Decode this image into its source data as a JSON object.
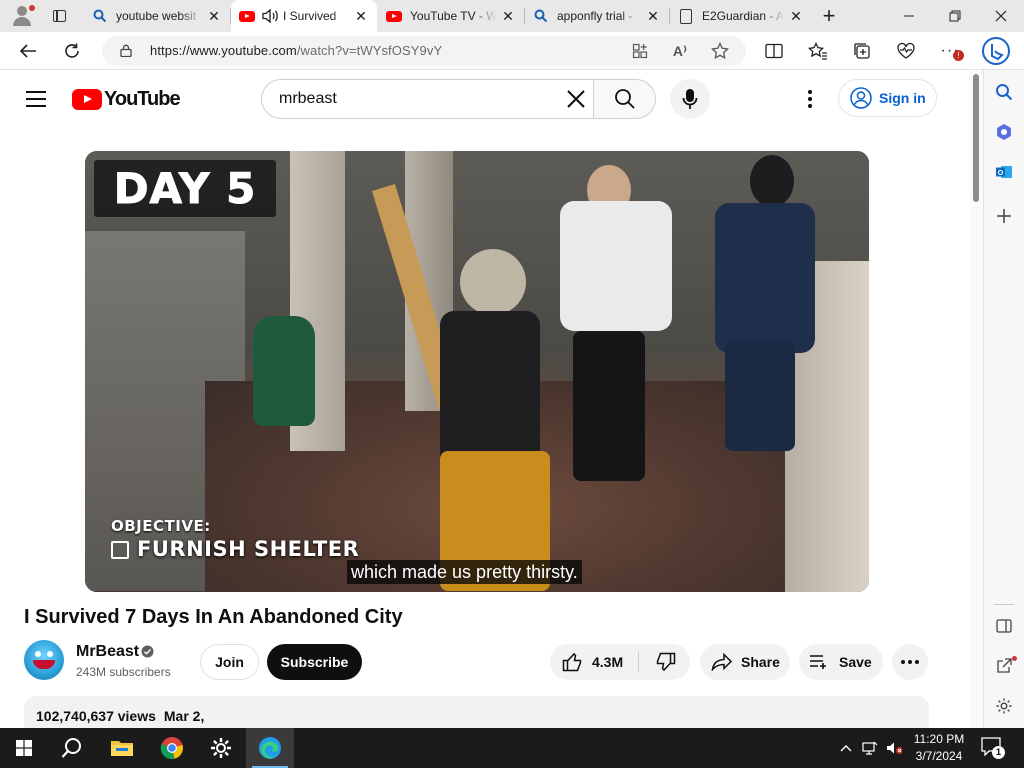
{
  "browser": {
    "tabs": [
      {
        "title": "youtube websit",
        "favicon": "search-icon",
        "active": false
      },
      {
        "title": "I Survived",
        "favicon": "youtube-icon",
        "active": true,
        "audio": true
      },
      {
        "title": "YouTube TV - W",
        "favicon": "youtube-icon",
        "active": false
      },
      {
        "title": "apponfly trial -",
        "favicon": "search-icon",
        "active": false
      },
      {
        "title": "E2Guardian - A",
        "favicon": "document-icon",
        "active": false
      }
    ],
    "address": {
      "url_prefix": "https://www.youtube.com",
      "url_rest": "/watch?v=tWYsfOSY9vY"
    },
    "colors": {
      "tab_strip": "#e8e8e8",
      "accent": "#0078d4"
    }
  },
  "youtube": {
    "logo_text": "YouTube",
    "search_query": "mrbeast",
    "sign_in_label": "Sign in",
    "video": {
      "overlay_day": "DAY 5",
      "objective_label": "OBJECTIVE:",
      "objective_task": "FURNISH SHELTER",
      "caption": "which made us pretty thirsty."
    },
    "title": "I Survived 7 Days In An Abandoned City",
    "channel": {
      "name": "MrBeast",
      "subscribers": "243M subscribers",
      "verified": true
    },
    "actions": {
      "join": "Join",
      "subscribe": "Subscribe",
      "likes": "4.3M",
      "share": "Share",
      "save": "Save"
    },
    "description": {
      "views": "102,740,637 views",
      "date": "Mar 2,"
    },
    "colors": {
      "brand_red": "#ff0000",
      "link_blue": "#065fd4",
      "subscribe_bg": "#0f0f0f"
    }
  },
  "taskbar": {
    "apps": [
      "start-icon",
      "search-icon",
      "file-explorer-icon",
      "chrome-icon",
      "settings-icon",
      "edge-icon"
    ],
    "time": "11:20 PM",
    "date": "3/7/2024",
    "notification_count": "1"
  }
}
